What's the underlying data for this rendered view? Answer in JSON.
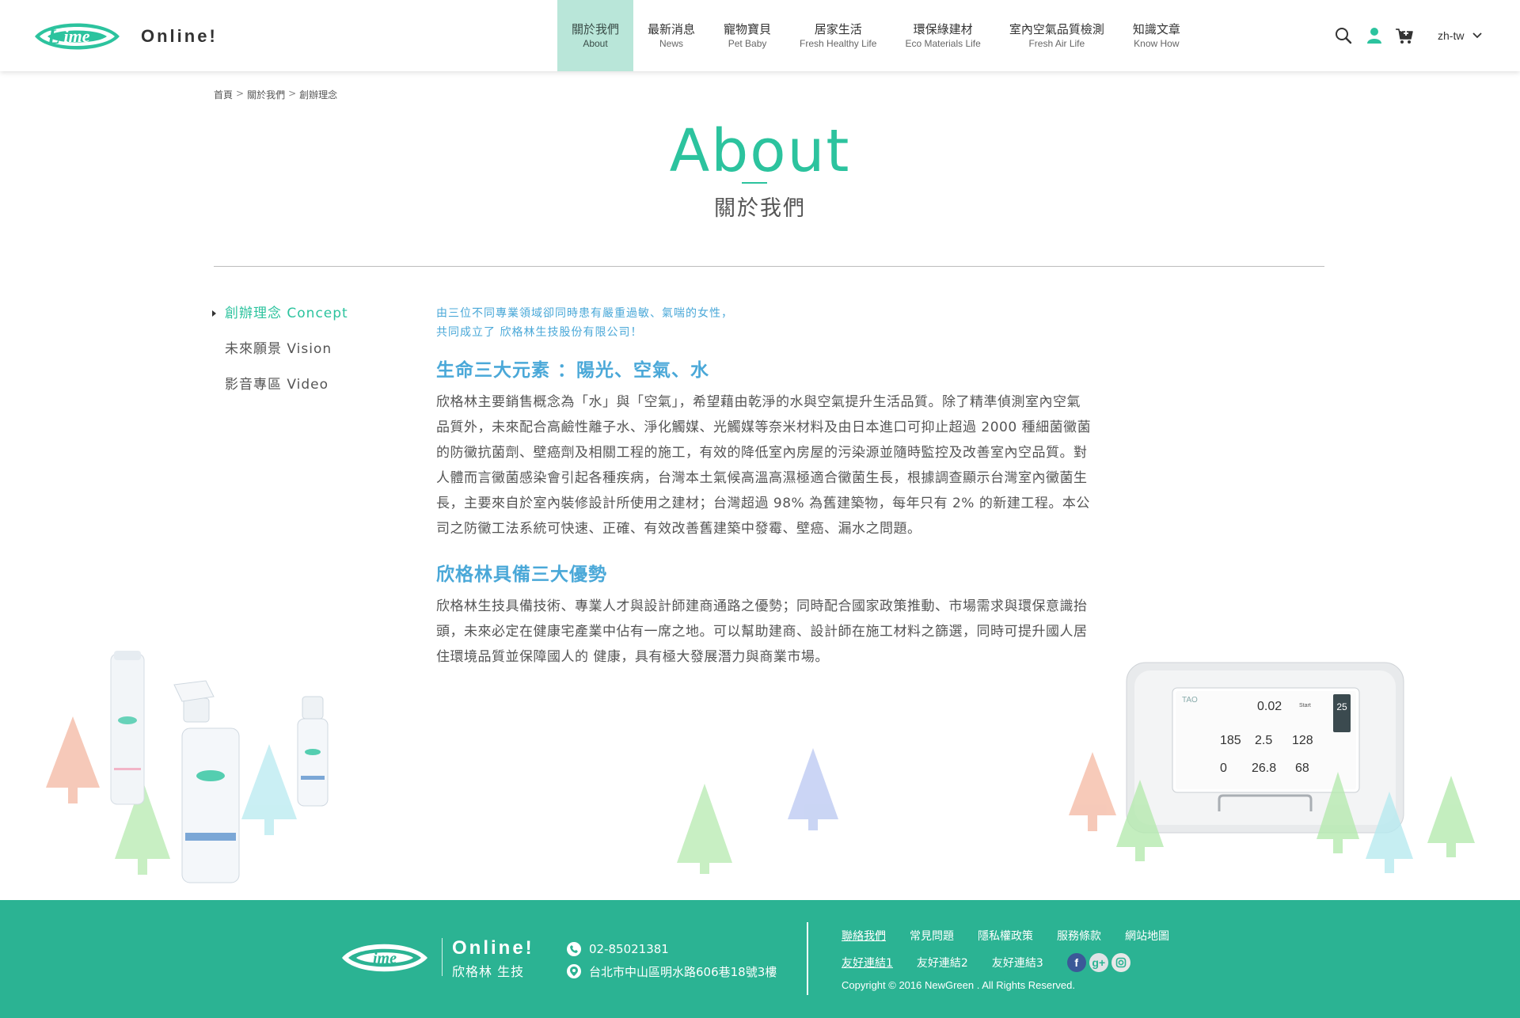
{
  "header": {
    "brand": "Online!",
    "nav": [
      {
        "zh": "關於我們",
        "en": "About",
        "active": true
      },
      {
        "zh": "最新消息",
        "en": "News"
      },
      {
        "zh": "寵物寶貝",
        "en": "Pet Baby"
      },
      {
        "zh": "居家生活",
        "en": "Fresh Healthy Life"
      },
      {
        "zh": "環保綠建材",
        "en": "Eco Materials Life"
      },
      {
        "zh": "室內空氣品質檢測",
        "en": "Fresh Air Life"
      },
      {
        "zh": "知識文章",
        "en": "Know How"
      }
    ],
    "icons": [
      "search-icon",
      "user-icon",
      "cart-icon"
    ],
    "language": "zh-tw"
  },
  "breadcrumb": [
    "首頁",
    "關於我們",
    "創辦理念"
  ],
  "breadcrumb_sep": ">",
  "title": {
    "en": "About",
    "zh": "關於我們"
  },
  "side_menu": [
    {
      "label": "創辦理念 Concept",
      "active": true
    },
    {
      "label": "未來願景 Vision"
    },
    {
      "label": "影音專區 Video"
    }
  ],
  "content": {
    "intro_line1": "由三位不同專業領域卻同時患有嚴重過敏、氣喘的女性，",
    "intro_line2": "共同成立了 欣格林生技股份有限公司！",
    "section1_title": "生命三大元素 ：陽光、空氣、水",
    "section1_text": "欣格林主要銷售概念為「水」與「空氣」，希望藉由乾淨的水與空氣提升生活品質。除了精準偵測室內空氣品質外，未來配合高鹼性離子水、淨化觸媒、光觸媒等奈米材料及由日本進口可抑止超過 2000 種細菌黴菌的防黴抗菌劑、壁癌劑及相關工程的施工，有效的降低室內房屋的污染源並隨時監控及改善室內空品質。對人體而言黴菌感染會引起各種疾病，台灣本土氣候高溫高濕極適合黴菌生長，根據調查顯示台灣室內黴菌生長，主要來自於室內裝修設計所使用之建材；台灣超過 98% 為舊建築物，每年只有 2% 的新建工程。本公司之防黴工法系統可快速、正確、有效改善舊建築中發霉、壁癌、漏水之問題。",
    "section2_title": "欣格林具備三大優勢",
    "section2_text": "欣格林生技具備技術、專業人才與設計師建商通路之優勢；同時配合國家政策推動、市場需求與環保意識抬頭，未來必定在健康宅產業中佔有一席之地。可以幫助建商、設計師在施工材料之篩選，同時可提升國人居住環境品質並保障國人的 健康，具有極大發展潛力與商業市場。"
  },
  "device": {
    "brand": "TAO",
    "top_value": "0.02",
    "start": "Start",
    "date": "25",
    "readings": [
      "185",
      "2.5",
      "128",
      "0",
      "26.8",
      "68"
    ]
  },
  "footer": {
    "brand": "Online!",
    "company": "欣格林 生技",
    "phone": "02-85021381",
    "address": "台北市中山區明水路606巷18號3樓",
    "links_row1": [
      "聯絡我們",
      "常見問題",
      "隱私權政策",
      "服務條款",
      "網站地圖"
    ],
    "links_row2": [
      "友好連結1",
      "友好連結2",
      "友好連結3"
    ],
    "social": [
      "facebook-icon",
      "google-plus-icon",
      "instagram-icon"
    ],
    "copyright": "Copyright © 2016 NewGreen . All Rights Reserved."
  },
  "colors": {
    "accent": "#2cc39e",
    "nav_active_bg": "#b9e6d9",
    "content_blue": "#4aa8d8",
    "footer_bg": "#2bb393"
  }
}
